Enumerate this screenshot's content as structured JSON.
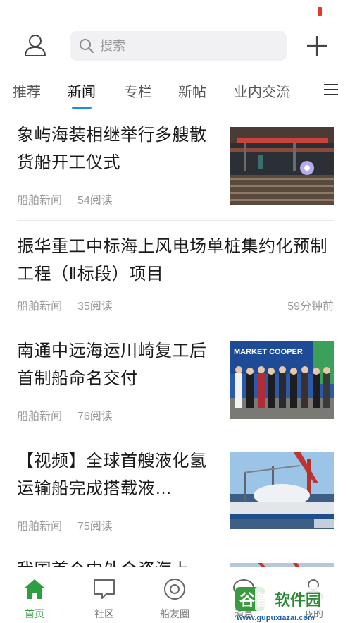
{
  "header": {
    "search_placeholder": "搜索"
  },
  "tabs": [
    {
      "label": "推荐",
      "active": false
    },
    {
      "label": "新闻",
      "active": true
    },
    {
      "label": "专栏",
      "active": false
    },
    {
      "label": "新帖",
      "active": false
    },
    {
      "label": "业内交流",
      "active": false
    }
  ],
  "articles": [
    {
      "title": "象屿海装相继举行多艘散货船开工仪式",
      "source": "船舶新闻",
      "reads": "54阅读",
      "time": ""
    },
    {
      "title": "振华重工中标海上风电场单桩集约化预制工程（Ⅱ标段）项目",
      "source": "船舶新闻",
      "reads": "35阅读",
      "time": "59分钟前"
    },
    {
      "title": "南通中远海运川崎复工后首制船命名交付",
      "source": "船舶新闻",
      "reads": "76阅读",
      "time": ""
    },
    {
      "title": "【视频】全球首艘液化氢运输船完成搭载液…",
      "source": "船舶新闻",
      "reads": "75阅读",
      "time": ""
    },
    {
      "title": "我国首个中外合资海上…",
      "source": "",
      "reads": "",
      "time": ""
    }
  ],
  "thumbs": {
    "photo3_banner": "MARKET COOPER"
  },
  "bottom_nav": [
    {
      "label": "首页",
      "active": true,
      "icon": "home-icon"
    },
    {
      "label": "社区",
      "active": false,
      "icon": "chat-bubble-icon"
    },
    {
      "label": "船友圈",
      "active": false,
      "icon": "circle-icon"
    },
    {
      "label": "消息",
      "active": false,
      "icon": "message-icon"
    },
    {
      "label": "我的",
      "active": false,
      "icon": "person-icon"
    }
  ],
  "watermark": {
    "brand": "谷普软件园",
    "url": "www.gupuxiazai.com"
  },
  "colors": {
    "accent_blue": "#1a8fe0",
    "nav_active_green": "#2e9f3f",
    "battery_red": "#e0392b"
  }
}
